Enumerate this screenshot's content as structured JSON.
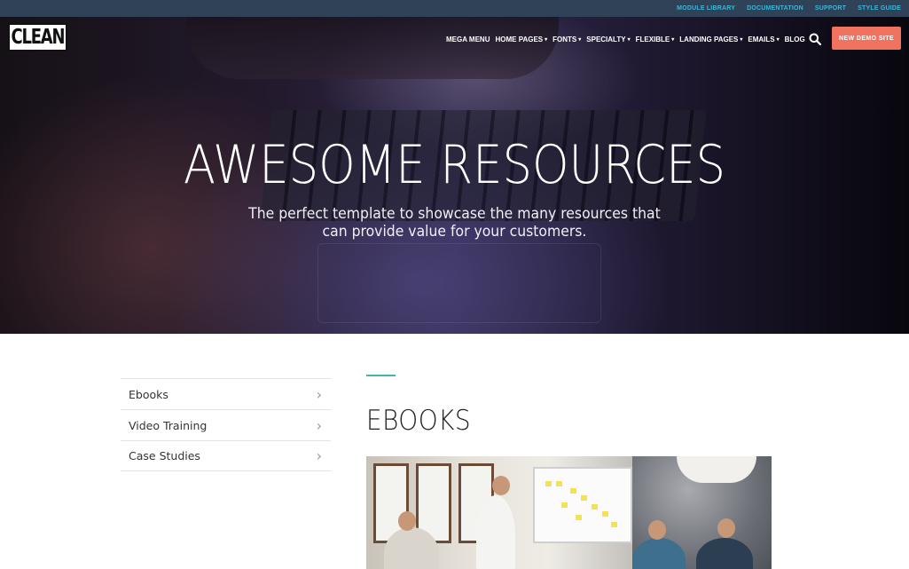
{
  "topbar": {
    "links": [
      "MODULE LIBRARY",
      "DOCUMENTATION",
      "SUPPORT",
      "STYLE GUIDE"
    ]
  },
  "brand": {
    "logo_text": "CLEAN"
  },
  "nav": {
    "items": [
      {
        "label": "MEGA MENU",
        "dropdown": false
      },
      {
        "label": "HOME PAGES",
        "dropdown": true
      },
      {
        "label": "FONTS",
        "dropdown": true
      },
      {
        "label": "SPECIALTY",
        "dropdown": true
      },
      {
        "label": "FLEXIBLE",
        "dropdown": true
      },
      {
        "label": "LANDING PAGES",
        "dropdown": true
      },
      {
        "label": "EMAILS",
        "dropdown": true
      },
      {
        "label": "BLOG",
        "dropdown": false
      }
    ],
    "chevron_glyph": "▾",
    "search_icon": "search-icon",
    "cta_label": "NEW DEMO SITE"
  },
  "hero": {
    "title": "AWESOME RESOURCES",
    "subtitle": "The perfect template to showcase the many resources that can provide value for your customers."
  },
  "sidebar": {
    "items": [
      {
        "label": "Ebooks",
        "arrow": "›"
      },
      {
        "label": "Video Training",
        "arrow": "›"
      },
      {
        "label": "Case Studies",
        "arrow": "›"
      }
    ]
  },
  "main": {
    "section_title": "EBOOKS",
    "image_alt": "team-meeting-photo"
  },
  "colors": {
    "topbar_bg": "#2f4258",
    "topbar_link": "#3fb6d6",
    "cta_bg": "#f0735f",
    "accent": "#3fb8a8"
  }
}
